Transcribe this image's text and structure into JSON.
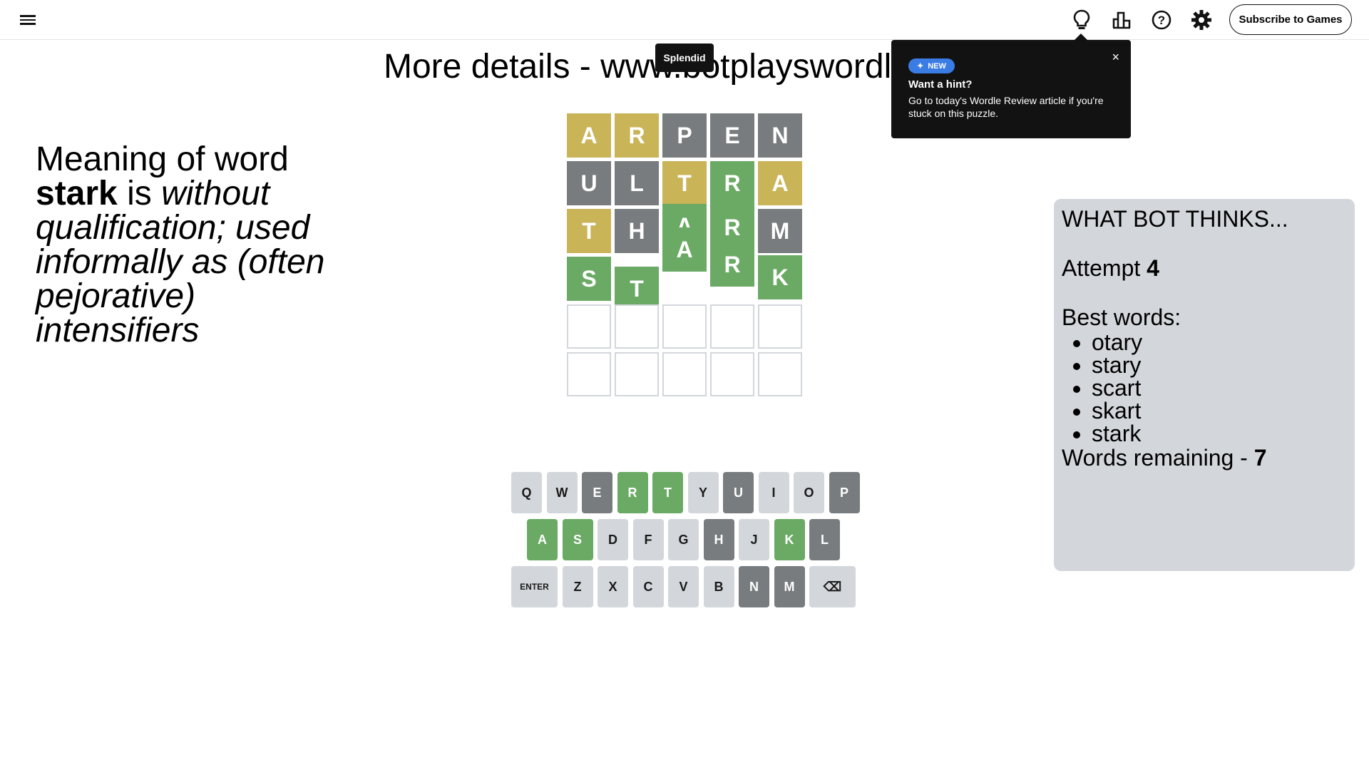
{
  "header": {
    "subscribe_label": "Subscribe to Games",
    "icons": [
      "menu-icon",
      "lightbulb-icon",
      "stats-icon",
      "help-icon",
      "settings-icon"
    ]
  },
  "site_note": "More details - www.botplayswordle.com",
  "toast": "Splendid",
  "popover": {
    "badge": "NEW",
    "title": "Want a hint?",
    "text": "Go to today's Wordle Review article if you're stuck on this puzzle.",
    "close": "×"
  },
  "meaning": {
    "prefix": "Meaning of word ",
    "word": "stark",
    "is": " is ",
    "definition": "without qualification; used informally as (often pejorative) intensifiers"
  },
  "board": {
    "rows": [
      [
        {
          "letter": "A",
          "state": "yellow"
        },
        {
          "letter": "R",
          "state": "yellow"
        },
        {
          "letter": "P",
          "state": "gray"
        },
        {
          "letter": "E",
          "state": "gray"
        },
        {
          "letter": "N",
          "state": "gray"
        }
      ],
      [
        {
          "letter": "U",
          "state": "gray"
        },
        {
          "letter": "L",
          "state": "gray"
        },
        {
          "letter": "T",
          "state": "yellow"
        },
        {
          "letter": "R",
          "state": "green"
        },
        {
          "letter": "A",
          "state": "yellow"
        }
      ],
      [
        {
          "letter": "T",
          "state": "yellow"
        },
        {
          "letter": "H",
          "state": "gray"
        },
        {
          "letter": "A",
          "state": "green"
        },
        {
          "letter": "R",
          "state": "green"
        },
        {
          "letter": "M",
          "state": "gray"
        }
      ],
      [
        {
          "letter": "S",
          "state": "green"
        },
        {
          "letter": "T",
          "state": "green"
        },
        {
          "letter": "A",
          "state": "green"
        },
        {
          "letter": "R",
          "state": "green"
        },
        {
          "letter": "K",
          "state": "green"
        }
      ],
      [
        {
          "letter": "",
          "state": "empty"
        },
        {
          "letter": "",
          "state": "empty"
        },
        {
          "letter": "",
          "state": "empty"
        },
        {
          "letter": "",
          "state": "empty"
        },
        {
          "letter": "",
          "state": "empty"
        }
      ],
      [
        {
          "letter": "",
          "state": "empty"
        },
        {
          "letter": "",
          "state": "empty"
        },
        {
          "letter": "",
          "state": "empty"
        },
        {
          "letter": "",
          "state": "empty"
        },
        {
          "letter": "",
          "state": "empty"
        }
      ]
    ]
  },
  "keyboard": {
    "rows": [
      [
        {
          "label": "Q",
          "state": "default"
        },
        {
          "label": "W",
          "state": "default"
        },
        {
          "label": "E",
          "state": "gray"
        },
        {
          "label": "R",
          "state": "green"
        },
        {
          "label": "T",
          "state": "green"
        },
        {
          "label": "Y",
          "state": "default"
        },
        {
          "label": "U",
          "state": "gray"
        },
        {
          "label": "I",
          "state": "default"
        },
        {
          "label": "O",
          "state": "default"
        },
        {
          "label": "P",
          "state": "gray"
        }
      ],
      [
        {
          "label": "A",
          "state": "green"
        },
        {
          "label": "S",
          "state": "green"
        },
        {
          "label": "D",
          "state": "default"
        },
        {
          "label": "F",
          "state": "default"
        },
        {
          "label": "G",
          "state": "default"
        },
        {
          "label": "H",
          "state": "gray"
        },
        {
          "label": "J",
          "state": "default"
        },
        {
          "label": "K",
          "state": "green"
        },
        {
          "label": "L",
          "state": "gray"
        }
      ],
      [
        {
          "label": "ENTER",
          "state": "default"
        },
        {
          "label": "Z",
          "state": "default"
        },
        {
          "label": "X",
          "state": "default"
        },
        {
          "label": "C",
          "state": "default"
        },
        {
          "label": "V",
          "state": "default"
        },
        {
          "label": "B",
          "state": "default"
        },
        {
          "label": "N",
          "state": "gray"
        },
        {
          "label": "M",
          "state": "gray"
        },
        {
          "label": "⌫",
          "state": "default"
        }
      ]
    ]
  },
  "bot": {
    "title": "WHAT BOT THINKS...",
    "attempt_label": "Attempt ",
    "attempt": "4",
    "best_label": "Best words:",
    "best_words": [
      "otary",
      "stary",
      "scart",
      "skart",
      "stark"
    ],
    "remaining_label": "Words remaining - ",
    "remaining": "7"
  },
  "colors": {
    "green": "#6aaa64",
    "yellow": "#c9b458",
    "gray": "#787c7e",
    "key_default": "#d3d6da"
  }
}
